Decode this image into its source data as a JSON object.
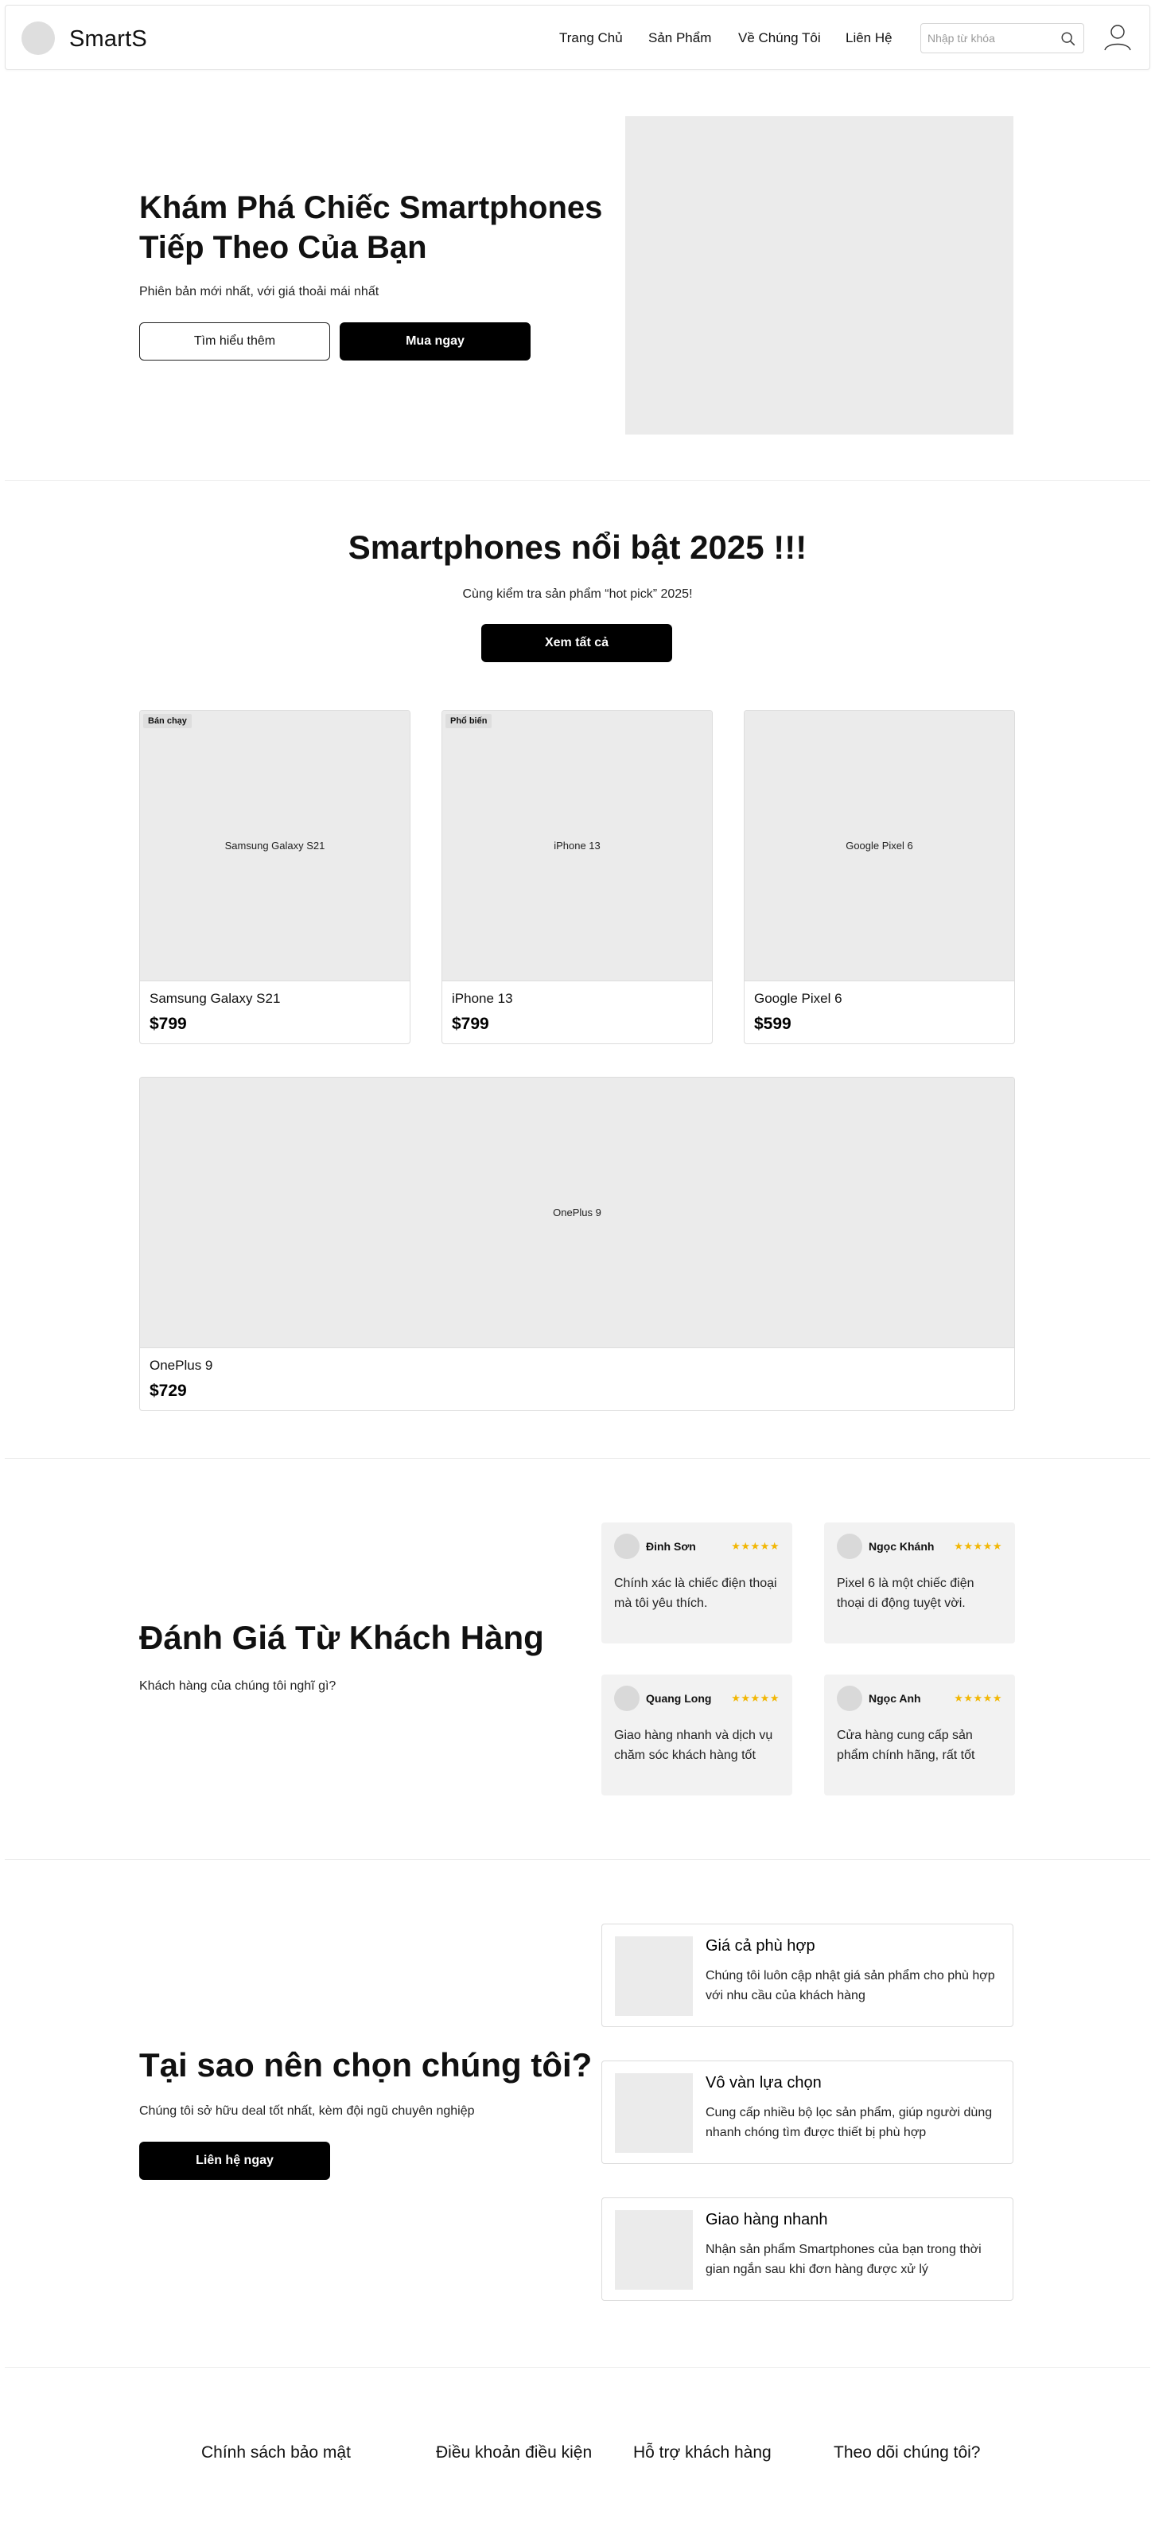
{
  "header": {
    "brand": "SmartS",
    "nav": [
      "Trang Chủ",
      "Sản Phẩm",
      "Về Chúng Tôi",
      "Liên Hệ"
    ],
    "search_placeholder": "Nhập từ khóa"
  },
  "hero": {
    "title": "Khám Phá Chiếc Smartphones Tiếp Theo Của Bạn",
    "subtitle": "Phiên bản mới nhất, với giá thoải mái nhất",
    "learn_more": "Tìm hiểu thêm",
    "buy_now": "Mua ngay"
  },
  "featured": {
    "title": "Smartphones nổi bật 2025 !!!",
    "subtitle": "Cùng kiểm tra sản phẩm “hot pick” 2025!",
    "view_all": "Xem tất cả",
    "products": [
      {
        "badge": "Bán chạy",
        "image_label": "Samsung Galaxy S21",
        "name": "Samsung Galaxy S21",
        "price": "$799"
      },
      {
        "badge": "Phổ biến",
        "image_label": "iPhone 13",
        "name": "iPhone 13",
        "price": "$799"
      },
      {
        "badge": "",
        "image_label": "Google Pixel 6",
        "name": "Google Pixel 6",
        "price": "$599"
      },
      {
        "badge": "",
        "image_label": "OnePlus 9",
        "name": "OnePlus 9",
        "price": "$729"
      }
    ]
  },
  "reviews": {
    "title": "Đánh Giá Từ Khách Hàng",
    "subtitle": "Khách hàng của chúng tôi nghĩ gì?",
    "items": [
      {
        "name": "Đinh Sơn",
        "stars": "★★★★★",
        "text": "Chính xác là chiếc điện thoại mà tôi yêu thích."
      },
      {
        "name": "Ngọc Khánh",
        "stars": "★★★★★",
        "text": "Pixel 6 là một chiếc điện thoại di động tuyệt vời."
      },
      {
        "name": "Quang Long",
        "stars": "★★★★★",
        "text": "Giao hàng nhanh và dịch vụ chăm sóc khách hàng tốt"
      },
      {
        "name": "Ngọc Anh",
        "stars": "★★★★★",
        "text": "Cửa hàng cung cấp sản phẩm chính hãng, rất tốt"
      }
    ],
    "star_color": "#f2b705"
  },
  "why_us": {
    "title": "Tại sao nên chọn chúng tôi?",
    "subtitle": "Chúng tôi sở hữu deal tốt nhất, kèm đội ngũ chuyên nghiệp",
    "contact": "Liên hệ ngay",
    "features": [
      {
        "title": "Giá cả phù hợp",
        "desc": "Chúng tôi luôn cập nhật giá sản phẩm cho phù hợp với nhu cầu của khách hàng"
      },
      {
        "title": "Vô vàn lựa chọn",
        "desc": "Cung cấp nhiều bộ lọc sản phẩm, giúp người dùng nhanh chóng tìm được thiết bị phù hợp"
      },
      {
        "title": "Giao hàng nhanh",
        "desc": "Nhận sản phẩm Smartphones của bạn trong thời gian ngắn sau khi đơn hàng được xử lý"
      }
    ]
  },
  "footer": {
    "links": [
      "Chính sách bảo mật",
      "Điều khoản điều kiện",
      "Hỗ trợ khách hàng",
      "Theo dõi chúng tôi?"
    ]
  }
}
